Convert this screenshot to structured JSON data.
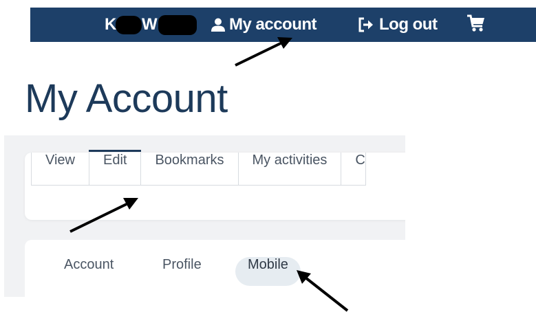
{
  "header": {
    "user_initial_1": "K",
    "user_initial_2": "W",
    "my_account_label": "My account",
    "logout_label": "Log out",
    "icons": [
      "user-icon",
      "sign-out-icon",
      "cart-icon"
    ]
  },
  "page": {
    "title": "My Account"
  },
  "tabs": [
    {
      "label": "View",
      "active": false
    },
    {
      "label": "Edit",
      "active": true
    },
    {
      "label": "Bookmarks",
      "active": false
    },
    {
      "label": "My activities",
      "active": false
    },
    {
      "label": "C",
      "active": false
    }
  ],
  "subtabs": [
    {
      "label": "Account",
      "active": false
    },
    {
      "label": "Profile",
      "active": false
    },
    {
      "label": "Mobile",
      "active": true
    }
  ],
  "colors": {
    "nav_bg": "#1d4069",
    "title": "#1d3a5a",
    "active_pill": "#e6ecf1",
    "content_bg": "#f1f2f4"
  }
}
